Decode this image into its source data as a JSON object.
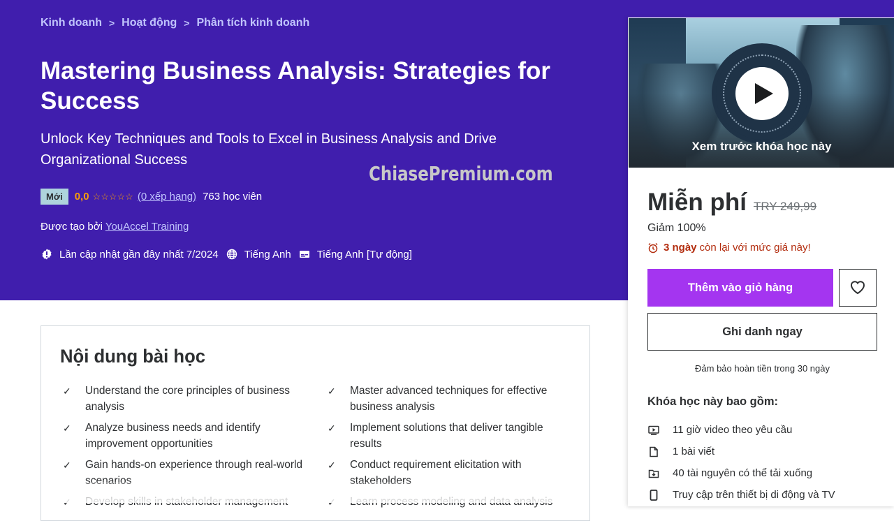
{
  "breadcrumb": [
    "Kinh doanh",
    "Hoạt động",
    "Phân tích kinh doanh"
  ],
  "breadcrumb_separator": ">",
  "course": {
    "title": "Mastering Business Analysis: Strategies for Success",
    "subtitle": "Unlock Key Techniques and Tools to Excel in Business Analysis and Drive Organizational Success",
    "badge": "Mới",
    "rating": "0,0",
    "stars": "☆☆☆☆☆",
    "rating_count_label": "(0 xếp hạng)",
    "students": "763 học viên",
    "created_by_label": "Được tạo bởi",
    "instructor": "YouAccel Training",
    "last_updated": "Lần cập nhật gần đây nhất 7/2024",
    "language": "Tiếng Anh",
    "captions": "Tiếng Anh [Tự động]"
  },
  "watermark": "ChiasePremium.com",
  "learn": {
    "title": "Nội dung bài học",
    "items": [
      "Understand the core principles of business analysis",
      "Master advanced techniques for effective business analysis",
      "Analyze business needs and identify improvement opportunities",
      "Implement solutions that deliver tangible results",
      "Gain hands-on experience through real-world scenarios",
      "Conduct requirement elicitation with stakeholders",
      "Develop skills in stakeholder management",
      "Learn process modeling and data analysis"
    ]
  },
  "sidebar": {
    "preview_label": "Xem trước khóa học này",
    "price": "Miễn phí",
    "original_price": "TRY 249,99",
    "discount": "Giảm 100%",
    "countdown_bold": "3 ngày",
    "countdown_rest": "còn lại với mức giá này!",
    "add_to_cart": "Thêm vào giỏ hàng",
    "enroll": "Ghi danh ngay",
    "guarantee": "Đảm bảo hoàn tiền trong 30 ngày",
    "includes_title": "Khóa học này bao gồm:",
    "includes": [
      {
        "icon": "video-icon",
        "text": "11 giờ video theo yêu cầu"
      },
      {
        "icon": "file-icon",
        "text": "1 bài viết"
      },
      {
        "icon": "download-folder-icon",
        "text": "40 tài nguyên có thể tải xuống"
      },
      {
        "icon": "mobile-icon",
        "text": "Truy cập trên thiết bị di động và TV"
      }
    ]
  },
  "colors": {
    "hero_bg": "#401ead",
    "accent_purple": "#a435f0",
    "rating_orange": "#f69c08",
    "link_lavender": "#c0c4fc",
    "countdown_red": "#b32d0f",
    "badge_new_bg": "#aed3dc"
  }
}
